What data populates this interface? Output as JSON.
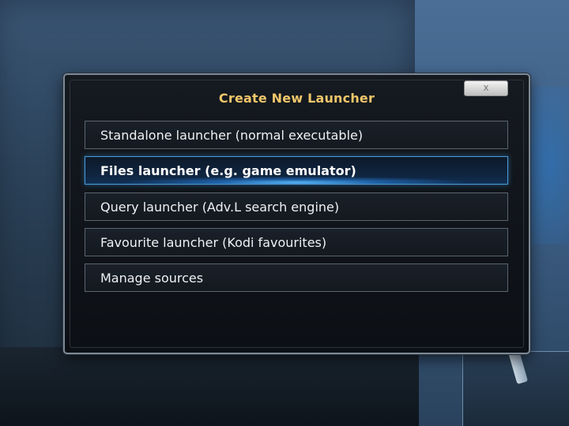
{
  "dialog": {
    "title": "Create New Launcher",
    "close_label": "x"
  },
  "menu": {
    "items": [
      {
        "label": "Standalone launcher (normal executable)",
        "selected": false
      },
      {
        "label": "Files launcher (e.g. game emulator)",
        "selected": true
      },
      {
        "label": "Query launcher (Adv.L search engine)",
        "selected": false
      },
      {
        "label": "Favourite launcher (Kodi favourites)",
        "selected": false
      },
      {
        "label": "Manage sources",
        "selected": false
      }
    ]
  },
  "colors": {
    "title": "#f0c66a",
    "selection_accent": "#4a9cd8",
    "dialog_background": "#10141a"
  },
  "icons": {
    "close": "close-icon"
  }
}
